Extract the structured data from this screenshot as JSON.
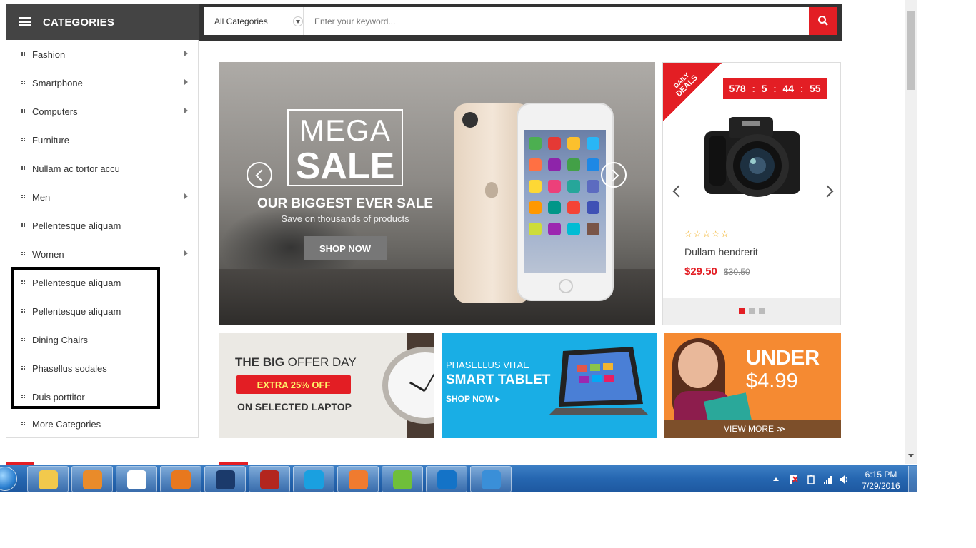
{
  "sidebar": {
    "header": "CATEGORIES",
    "items": [
      {
        "label": "Fashion",
        "has_submenu": true
      },
      {
        "label": "Smartphone",
        "has_submenu": true
      },
      {
        "label": "Computers",
        "has_submenu": true
      },
      {
        "label": "Furniture",
        "has_submenu": false
      },
      {
        "label": "Nullam ac tortor accu",
        "has_submenu": false
      },
      {
        "label": "Men",
        "has_submenu": true
      },
      {
        "label": "Pellentesque aliquam",
        "has_submenu": false
      },
      {
        "label": "Women",
        "has_submenu": true
      },
      {
        "label": "Pellentesque aliquam",
        "has_submenu": false
      },
      {
        "label": "Pellentesque aliquam",
        "has_submenu": false
      },
      {
        "label": "Dining Chairs",
        "has_submenu": false
      },
      {
        "label": "Phasellus sodales",
        "has_submenu": false
      },
      {
        "label": "Duis porttitor",
        "has_submenu": false
      },
      {
        "label": "More Categories",
        "has_submenu": false
      }
    ]
  },
  "search": {
    "category": "All Categories",
    "placeholder": "Enter your keyword..."
  },
  "hero": {
    "mega": "MEGA",
    "sale": "SALE",
    "heading": "OUR BIGGEST EVER SALE",
    "subheading": "Save on thousands of products",
    "button": "SHOP NOW"
  },
  "deal": {
    "ribbon_line1": "DAILY",
    "ribbon_line2": "DEALS",
    "countdown": {
      "days": "578",
      "hours": "5",
      "minutes": "44",
      "seconds": "55"
    },
    "stars": "☆☆☆☆☆",
    "rating": 0,
    "product_name": "Dullam hendrerit",
    "price": "$29.50",
    "old_price": "$30.50"
  },
  "banners": {
    "offer": {
      "title_bold": "THE BIG",
      "title_rest": " OFFER DAY",
      "badge": "EXTRA 25% OFF",
      "sub": "ON SELECTED LAPTOP"
    },
    "tablet": {
      "line1": "PHASELLUS VITAE",
      "line2": "SMART TABLET",
      "link": "SHOP NOW ▸"
    },
    "under": {
      "title": "UNDER",
      "price": "$4.99",
      "link": "VIEW MORE ≫"
    }
  },
  "taskbar": {
    "apps": [
      "file-explorer",
      "media-player",
      "chrome",
      "firefox",
      "sourcetree",
      "filezilla",
      "skype",
      "xampp",
      "dreamweaver",
      "teamviewer",
      "downloader"
    ],
    "time": "6:15 PM",
    "date": "7/29/2016"
  },
  "colors": {
    "accent": "#e31e24",
    "header_bg": "#444444",
    "taskbar": "#2566b0",
    "tablet_bg": "#19aee5",
    "under_bg": "#f58a32"
  }
}
